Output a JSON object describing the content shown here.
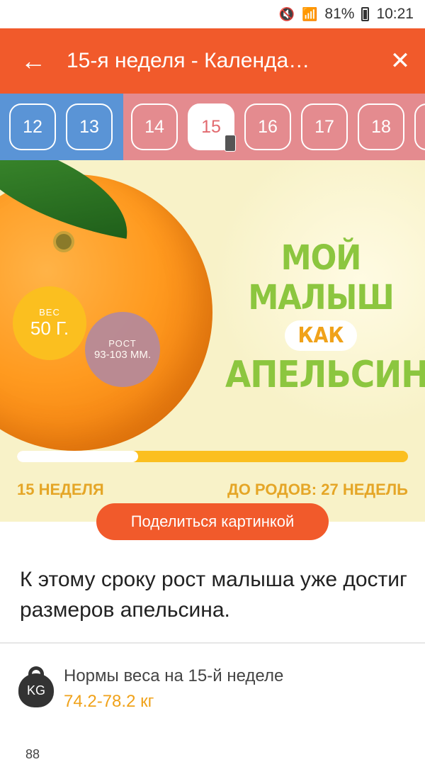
{
  "status": {
    "battery": "81%",
    "time": "10:21"
  },
  "appbar": {
    "title": "15-я неделя - Календа…"
  },
  "weeks": {
    "past": [
      "12",
      "13"
    ],
    "current": "15",
    "future_before": [
      "14"
    ],
    "future_after": [
      "16",
      "17",
      "18"
    ]
  },
  "hero": {
    "weight_label": "ВЕС",
    "weight_value": "50 Г.",
    "height_label": "РОСТ",
    "height_value": "93-103 ММ.",
    "headline_l1": "МОЙ МАЛЫШ",
    "headline_kak": "КАК",
    "headline_l3": "АПЕЛЬСИН",
    "progress_fraction": 0.31,
    "week_label": "15 НЕДЕЛЯ",
    "due_label": "ДО РОДОВ: 27 НЕДЕЛЬ"
  },
  "share_label": "Поделиться картинкой",
  "description": "К этому сроку рост малыша уже достиг размеров апельсина.",
  "norm": {
    "icon_text": "KG",
    "title": "Нормы веса на 15-й неделе",
    "value": "74.2-78.2 кг"
  },
  "cut_text": "88",
  "colors": {
    "accent": "#f15a2b",
    "past_weeks": "#5a94d6",
    "future_weeks": "#e48b8f",
    "green": "#8cc63f",
    "yellow": "#fbbf1f"
  }
}
